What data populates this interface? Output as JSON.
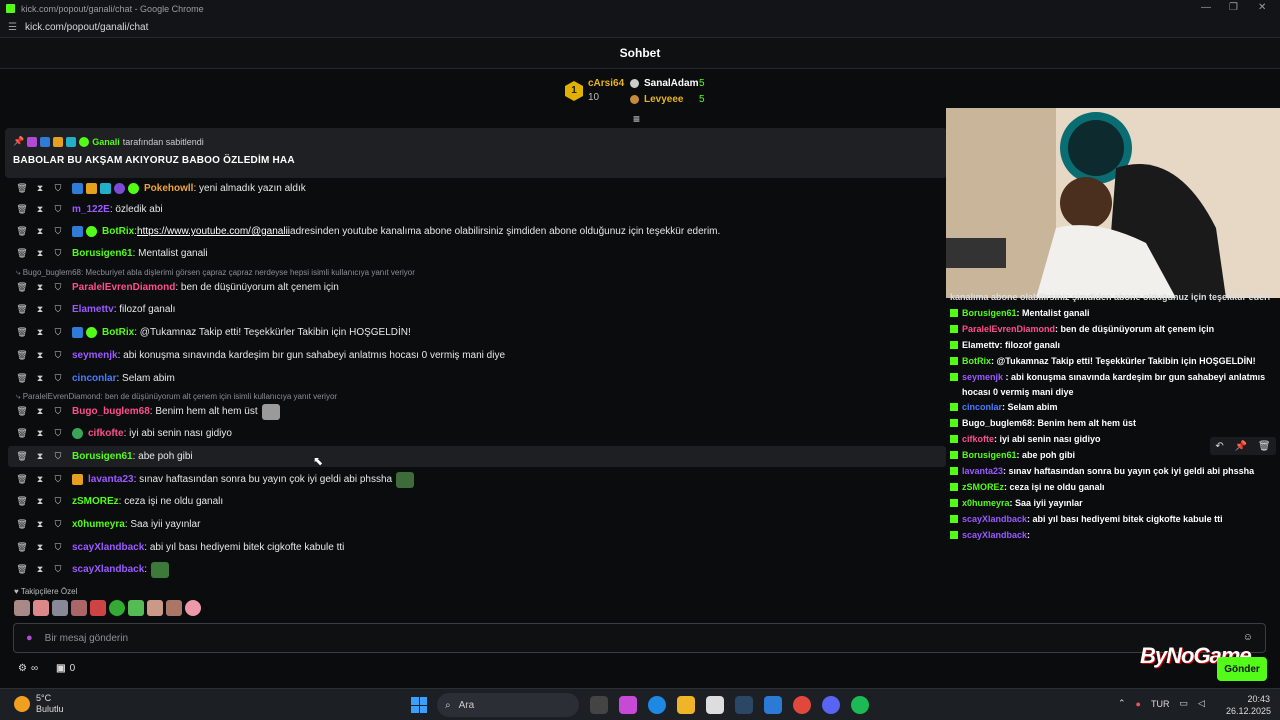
{
  "browser": {
    "window_title": "kick.com/popout/ganali/chat - Google Chrome",
    "url": "kick.com/popout/ganali/chat"
  },
  "header": {
    "title": "Sohbet"
  },
  "gifters": {
    "first": {
      "name": "cArsi64",
      "count": "10",
      "rank": "1"
    },
    "second": {
      "name": "SanalAdam",
      "count": "5"
    },
    "third": {
      "name": "Levyeee",
      "count": "5"
    }
  },
  "pinned": {
    "user": "Ganali",
    "by_text": "tarafından sabitlendi",
    "message": "BABOLAR BU AKŞAM AKIYORUZ BABOO ÖZLEDİM HAA"
  },
  "messages": [
    {
      "user": "Pokehowll",
      "color": "#f0a33c",
      "text": ": yeni almadık yazın aldık"
    },
    {
      "user": "m_122E",
      "color": "#9b59ff",
      "text": ": özledik abi"
    },
    {
      "user": "BotRix",
      "color": "#53fc18",
      "text": " adresinden youtube kanalıma abone olabilirsiniz şimdiden abone olduğunuz için teşekkür ederim.",
      "link": "https://www.youtube.com/@ganalii",
      "link_prefix": ": "
    },
    {
      "user": "Borusigen61",
      "color": "#53fc18",
      "text": ": Mentalist ganali"
    },
    {
      "user": "ParalelEvrenDiamond",
      "color": "#ff4f8b",
      "text": ": ben de düşünüyorum alt çenem için"
    },
    {
      "user": "Elamettv",
      "color": "#9b59ff",
      "text": ": filozof ganalı"
    },
    {
      "user": "BotRix",
      "color": "#53fc18",
      "text": ": @Tukamnaz Takip etti! Teşekkürler Takibin için HOŞGELDİN!"
    },
    {
      "user": "seymenjk",
      "color": "#9b59ff",
      "text": ": abi konuşma sınavında kardeşim bır gun sahabeyi anlatmıs hocası 0 vermiş mani diye"
    },
    {
      "user": "cinconlar",
      "color": "#4a7cff",
      "text": ": Selam abim"
    },
    {
      "user": "Bugo_buglem68",
      "color": "#ff4f8b",
      "text": ": Benim hem alt hem üst"
    },
    {
      "user": "cifkofte",
      "color": "#ff4f8b",
      "text": ": iyi abi senin nası gidiyo"
    },
    {
      "user": "Borusigen61",
      "color": "#53fc18",
      "text": ": abe poh gibi"
    },
    {
      "user": "lavanta23",
      "color": "#9b59ff",
      "text": ": sınav haftasından sonra bu yayın çok iyi geldi abi phssha"
    },
    {
      "user": "zSMOREz",
      "color": "#53fc18",
      "text": ": ceza işi ne oldu ganalı"
    },
    {
      "user": "x0humeyra",
      "color": "#53fc18",
      "text": ": Saa iyii yayınlar"
    },
    {
      "user": "scayXlandback",
      "color": "#9b59ff",
      "text": ": abi yıl bası hediyemi bitek cigkofte kabule tti"
    },
    {
      "user": "scayXlandback",
      "color": "#9b59ff",
      "text": ":"
    }
  ],
  "replies": [
    "Bugo_buglem68: Mecburiyet abla dişlerimi görsen çapraz çapraz nerdeyse hepsi isimli kullanıcıya yanıt veriyor",
    "ParalelEvrenDiamond: ben de düşünüyorum alt çenem için isimli kullanıcıya yanıt veriyor"
  ],
  "followers_label": "Takipçilere Özel",
  "chat_input": {
    "placeholder": "Bir mesaj gönderin"
  },
  "bottom": {
    "count": "0"
  },
  "send_label": "Gönder",
  "overlay": {
    "header_fragment": "kanalıma abone olabilirsiniz şimdiden abone olduğunuz için teşekkür ederim.",
    "lines": [
      {
        "user": "Borusigen61",
        "color": "#53fc18",
        "text": " : Mentalist ganali"
      },
      {
        "user": "ParalelEvrenDiamond",
        "color": "#ff4f8b",
        "text": " : ben de düşünüyorum alt çenem için"
      },
      {
        "user": "Elamettv",
        "color": "#fff",
        "text": " : filozof ganalı"
      },
      {
        "user": "BotRix",
        "color": "#53fc18",
        "text": " : @Tukamnaz Takip etti! Teşekkürler Takibin için HOŞGELDİN!"
      },
      {
        "user": "seymenjk",
        "color": "#9b59ff",
        "text": " : abi konuşma sınavında kardeşim bır gun sahabeyi anlatmıs hocası 0 vermiş mani diye"
      },
      {
        "user": "cinconlar",
        "color": "#4a7cff",
        "text": " : Selam abim"
      },
      {
        "user": "Bugo_buglem68",
        "color": "#fff",
        "text": " : Benim hem alt hem üst"
      },
      {
        "user": "cifkofte",
        "color": "#ff4f8b",
        "text": " : iyi abi senin nası gidiyo"
      },
      {
        "user": "Borusigen61",
        "color": "#53fc18",
        "text": " : abe poh gibi"
      },
      {
        "user": "lavanta23",
        "color": "#9b59ff",
        "text": " : sınav haftasından sonra bu yayın çok iyi geldi abi phssha"
      },
      {
        "user": "zSMOREz",
        "color": "#53fc18",
        "text": " : ceza işi ne oldu ganalı"
      },
      {
        "user": "x0humeyra",
        "color": "#53fc18",
        "text": " : Saa iyii yayınlar"
      },
      {
        "user": "scayXlandback",
        "color": "#9b59ff",
        "text": " : abi yıl bası hediyemi bitek cigkofte kabule tti"
      },
      {
        "user": "scayXlandback",
        "color": "#9b59ff",
        "text": " :"
      }
    ]
  },
  "watermark": "ByNoGame",
  "taskbar": {
    "temp": "5°C",
    "weather": "Bulutlu",
    "search": "Ara",
    "lang": "TUR",
    "time": "20:43",
    "date": "26.12.2025"
  },
  "colors": {
    "kick_green": "#53fc18",
    "gold": "#e6b422"
  }
}
